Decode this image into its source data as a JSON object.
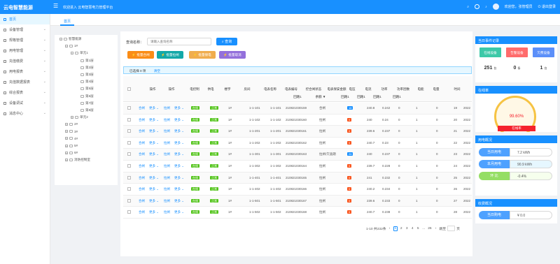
{
  "app": {
    "title": "云电智慧能源",
    "welcome": "欢迎进入 云电智慧电力管理平台",
    "user": "欢迎您，张管理员",
    "logout": "退出登录"
  },
  "sidebar": {
    "items": [
      {
        "label": "首页",
        "active": true
      },
      {
        "label": "设备管理"
      },
      {
        "label": "规格管理"
      },
      {
        "label": "用电管理"
      },
      {
        "label": "充值缴费"
      },
      {
        "label": "用电报表"
      },
      {
        "label": "充值数据报表"
      },
      {
        "label": "综合报表"
      },
      {
        "label": "设备调试"
      },
      {
        "label": "消息中心"
      }
    ]
  },
  "tabs": [
    {
      "label": "首页"
    }
  ],
  "tree": [
    {
      "label": "智慧能源",
      "level": 0
    },
    {
      "label": "1#",
      "level": 1
    },
    {
      "label": "单元1",
      "level": 2
    },
    {
      "label": "第1层",
      "level": 3
    },
    {
      "label": "第2层",
      "level": 3
    },
    {
      "label": "第3层",
      "level": 3
    },
    {
      "label": "第4层",
      "level": 3
    },
    {
      "label": "第5层",
      "level": 3
    },
    {
      "label": "第6层",
      "level": 3
    },
    {
      "label": "第7层",
      "level": 3
    },
    {
      "label": "第8层",
      "level": 3
    },
    {
      "label": "单元2",
      "level": 2
    },
    {
      "label": "2#",
      "level": 1
    },
    {
      "label": "3#",
      "level": 1
    },
    {
      "label": "4#",
      "level": 1
    },
    {
      "label": "5#",
      "level": 1
    },
    {
      "label": "6#",
      "level": 1
    },
    {
      "label": "消防控制室",
      "level": 1
    }
  ],
  "search": {
    "label": "查询名称：",
    "placeholder": "请输入查询名称",
    "button": "查询"
  },
  "actions": [
    {
      "label": "批量合闸",
      "color": "#fa8c16"
    },
    {
      "label": "批量拉闸",
      "color": "#13a8a8"
    },
    {
      "label": "批量保电",
      "color": "#f0ad4e"
    },
    {
      "label": "批量取消",
      "color": "#9370db"
    }
  ],
  "selection": {
    "text": "已选择 0 项",
    "clear": "清空"
  },
  "table": {
    "headers": [
      "操作",
      "操作",
      "电控制",
      "供电",
      "楼宇",
      "房间",
      "电表名称",
      "电表编号",
      "控合闸状态",
      "电表保安金额",
      "电压",
      "电流",
      "功率",
      "功率因数",
      "电能",
      "电量",
      "时间"
    ],
    "subheaders": {
      "voltage": "回路1",
      "current": "回路1",
      "power": "回路1",
      "factor": "回路1",
      "control": "回路1",
      "balance": "余额 ▼"
    },
    "op_links": {
      "a": "合闸",
      "b": "更多",
      "c": "拉闸",
      "d": "更多"
    },
    "rows": [
      {
        "building": "1#",
        "room": "1-1-101",
        "name": "1-1-101",
        "code": "210821030159",
        "state": "合闸",
        "bal": "16",
        "balc": "b",
        "v": "240.8",
        "i": "0.242",
        "p": "0",
        "f": "1",
        "e": "0",
        "q": "19",
        "t": "2022"
      },
      {
        "building": "1#",
        "room": "1-1-102",
        "name": "1-1-102",
        "code": "210821030160",
        "state": "拉闸",
        "bal": "0",
        "balc": "o",
        "v": "240",
        "i": "0.24",
        "p": "0",
        "f": "1",
        "e": "0",
        "q": "20",
        "t": "2022"
      },
      {
        "building": "1#",
        "room": "1-1-201",
        "name": "1-1-201",
        "code": "210821030161",
        "state": "拉闸",
        "bal": "0",
        "balc": "o",
        "v": "239.6",
        "i": "0.237",
        "p": "0",
        "f": "1",
        "e": "0",
        "q": "21",
        "t": "2022"
      },
      {
        "building": "1#",
        "room": "1-1-202",
        "name": "1-1-202",
        "code": "210821030162",
        "state": "拉闸",
        "bal": "0",
        "balc": "o",
        "v": "240.7",
        "i": "0.23",
        "p": "0",
        "f": "1",
        "e": "0",
        "q": "22",
        "t": "2022"
      },
      {
        "building": "1#",
        "room": "1-1-301",
        "name": "1-1-301",
        "code": "210821030163",
        "state": "拉闸/欠逾期",
        "bal": "26",
        "balc": "b",
        "v": "240",
        "i": "0.237",
        "p": "0",
        "f": "1",
        "e": "0",
        "q": "23",
        "t": "2022"
      },
      {
        "building": "1#",
        "room": "1-1-302",
        "name": "1-1-302",
        "code": "210821030164",
        "state": "拉闸",
        "bal": "0",
        "balc": "o",
        "v": "239.7",
        "i": "0.228",
        "p": "0",
        "f": "1",
        "e": "0",
        "q": "24",
        "t": "2022"
      },
      {
        "building": "1#",
        "room": "1-1-401",
        "name": "1-1-401",
        "code": "210821030165",
        "state": "拉闸",
        "bal": "0",
        "balc": "o",
        "v": "241",
        "i": "0.232",
        "p": "0",
        "f": "1",
        "e": "0",
        "q": "25",
        "t": "2022"
      },
      {
        "building": "1#",
        "room": "1-1-402",
        "name": "1-1-402",
        "code": "210821030166",
        "state": "拉闸",
        "bal": "0",
        "balc": "o",
        "v": "240.2",
        "i": "0.234",
        "p": "0",
        "f": "1",
        "e": "0",
        "q": "26",
        "t": "2022"
      },
      {
        "building": "1#",
        "room": "1-1-501",
        "name": "1-1-501",
        "code": "210821030167",
        "state": "拉闸",
        "bal": "0",
        "balc": "o",
        "v": "239.6",
        "i": "0.233",
        "p": "0",
        "f": "1",
        "e": "0",
        "q": "27",
        "t": "2022"
      },
      {
        "building": "1#",
        "room": "1-1-502",
        "name": "1-1-502",
        "code": "210821030168",
        "state": "拉闸",
        "bal": "0",
        "balc": "o",
        "v": "240.7",
        "i": "0.238",
        "p": "0",
        "f": "1",
        "e": "0",
        "q": "28",
        "t": "2022"
      }
    ],
    "tag_on": "在线",
    "tag_power": "正常"
  },
  "pager": {
    "summary": "1-10 共232条",
    "pages": [
      "1",
      "2",
      "3",
      "4",
      "5",
      "...",
      "26"
    ],
    "goto": "跳至",
    "unit": "页"
  },
  "cards": {
    "today": {
      "title": "当日事件记录",
      "boxes": [
        {
          "label": "在线设备",
          "value": "251",
          "unit": "台",
          "color": "#3cc9a8"
        },
        {
          "label": "告警设备",
          "value": "0",
          "unit": "条",
          "color": "#ff6b6b"
        },
        {
          "label": "欠费设备",
          "value": "1",
          "unit": "台",
          "color": "#5b8ff9"
        }
      ]
    },
    "rate": {
      "title": "在线率",
      "value": "99.60%",
      "ribbon": "在线率"
    },
    "usage": {
      "title": "用电概况",
      "items": [
        {
          "k": "当日用电",
          "v": "7.2 kWh",
          "color": "#4ea1ff",
          "bg": "#fff"
        },
        {
          "k": "本月用电",
          "v": "90.9 kWh",
          "color": "#4ea1ff",
          "bg": "#e6f7ff"
        },
        {
          "k": "环 比",
          "v": "-0.4%",
          "color": "#95de64",
          "bg": "#f6ffed"
        }
      ]
    },
    "recharge": {
      "title": "收费概况",
      "items": [
        {
          "k": "当日购电",
          "v": "¥ 0.0",
          "color": "#4ea1ff"
        }
      ]
    }
  }
}
